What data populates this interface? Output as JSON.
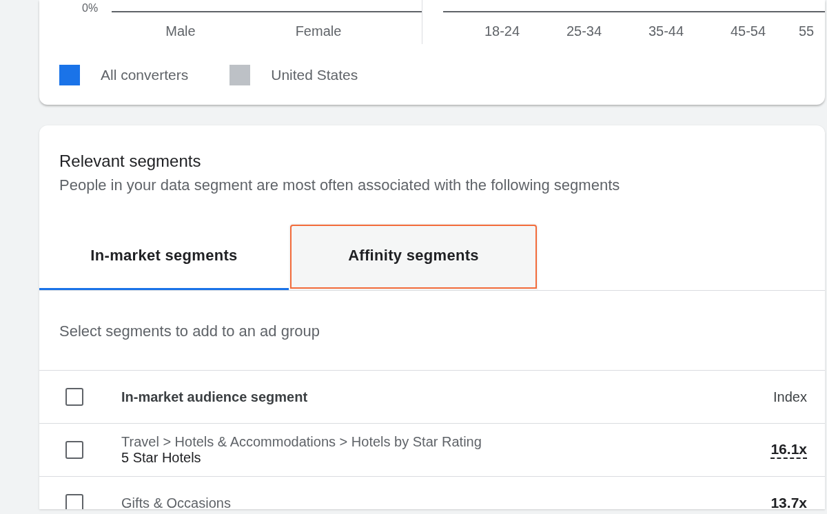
{
  "demographics_chart": {
    "y_tick": "0%",
    "gender_labels": [
      "Male",
      "Female"
    ],
    "age_labels": [
      "18-24",
      "25-34",
      "35-44",
      "45-54",
      "55"
    ],
    "legend": [
      {
        "label": "All converters",
        "color": "#1a73e8"
      },
      {
        "label": "United States",
        "color": "#bdc1c6"
      }
    ]
  },
  "relevant_segments": {
    "title": "Relevant segments",
    "subtitle": "People in your data segment are most often associated with the following segments",
    "tabs": [
      {
        "label": "In-market segments",
        "selected": true,
        "highlighted": false
      },
      {
        "label": "Affinity segments",
        "selected": false,
        "highlighted": true
      }
    ],
    "hint": "Select segments to add to an ad group",
    "table": {
      "columns": [
        "In-market audience segment",
        "Index"
      ],
      "header_checked": false,
      "rows": [
        {
          "path": "Travel > Hotels & Accommodations > Hotels by Star Rating",
          "name": "5 Star Hotels",
          "index": "16.1x",
          "checked": false
        },
        {
          "path": "Gifts & Occasions",
          "index": "13.7x",
          "checked": false
        }
      ]
    }
  }
}
